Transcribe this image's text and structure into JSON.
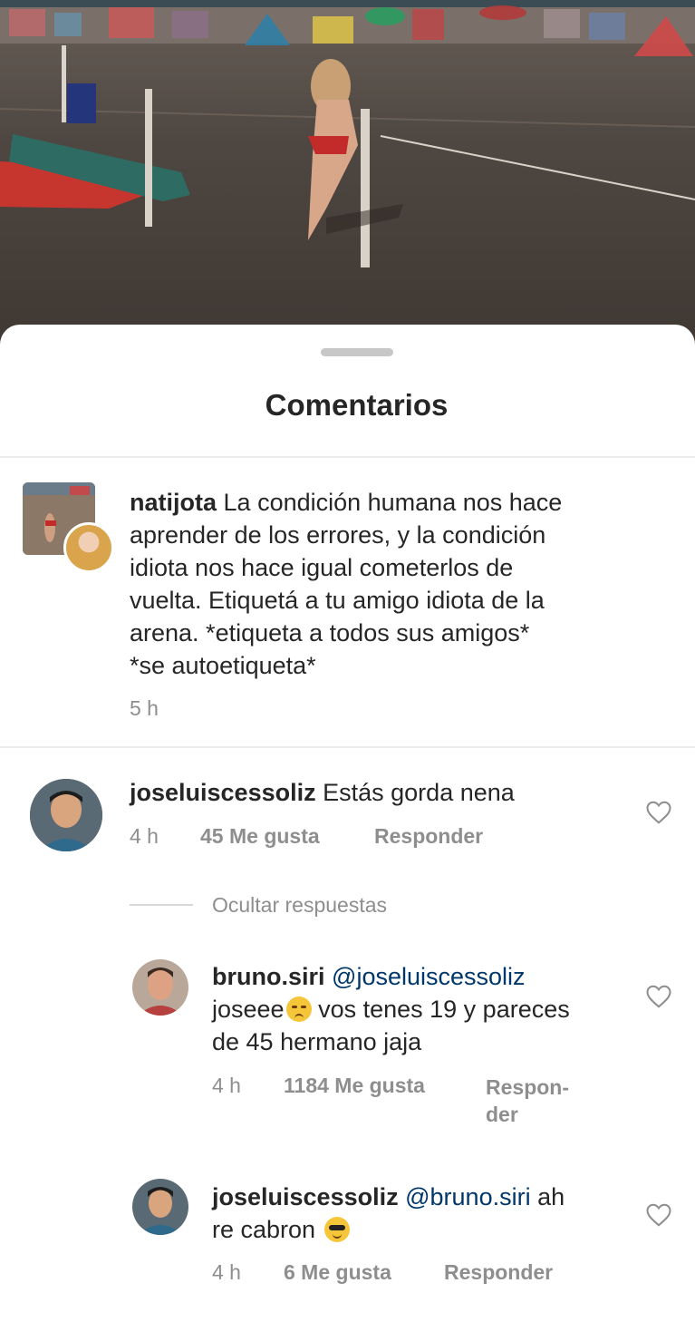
{
  "sheet": {
    "title": "Comentarios"
  },
  "caption": {
    "username": "natijota",
    "lines": [
      "La condición humana nos hace",
      "aprender de los errores, y la condición",
      "idiota nos hace igual cometerlos de",
      "vuelta. Etiquetá a tu amigo idiota de la",
      "arena. *etiqueta a todos sus amigos*",
      "*se autoetiqueta*"
    ],
    "time": "5 h"
  },
  "comments": [
    {
      "username": "joseluiscessoliz",
      "text": "Estás gorda nena",
      "time": "4 h",
      "likes": "45 Me gusta",
      "reply": "Responder"
    }
  ],
  "hide_replies": "Ocultar respuestas",
  "replies": [
    {
      "username": "bruno.siri",
      "mention": "@joseluiscessoliz",
      "line2_a": "joseee",
      "line2_b": " vos tenes 19 y pareces",
      "line3": "de 45 hermano jaja",
      "time": "4 h",
      "likes": "1184 Me gusta",
      "reply_a": "Respon-",
      "reply_b": "der"
    },
    {
      "username": "joseluiscessoliz",
      "mention": "@bruno.siri",
      "after_mention": " ah",
      "line2": "re cabron",
      "time": "4 h",
      "likes": "6 Me gusta",
      "reply": "Responder"
    }
  ],
  "icons": {
    "like": "heart-outline-icon",
    "emoji_sad": "unamused-face-emoji",
    "emoji_cool": "sunglasses-face-emoji"
  }
}
